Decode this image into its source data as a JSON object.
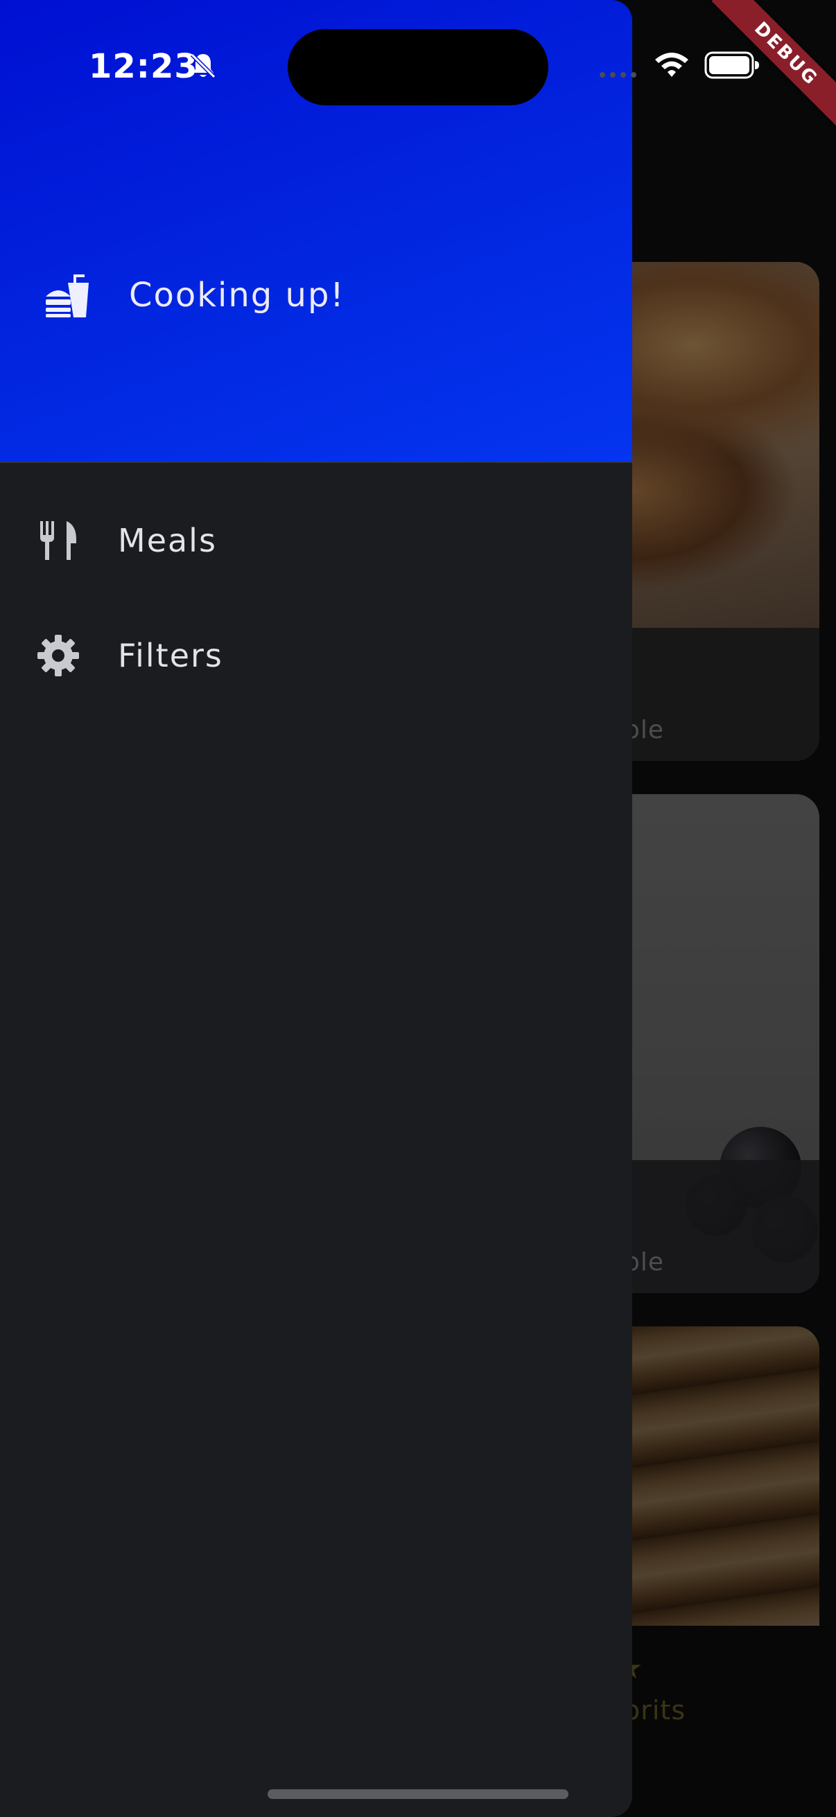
{
  "status_bar": {
    "time": "12:23",
    "icons": [
      "bell-slash-icon",
      "cellular-signal-icon",
      "wifi-icon",
      "battery-icon"
    ]
  },
  "debug_banner": {
    "label": "DEBUG",
    "color": "#8a1f2a"
  },
  "drawer": {
    "header": {
      "icon": "fastfood-icon",
      "title": "Cooking up!",
      "gradient": [
        "#0010d2",
        "#0435f0"
      ]
    },
    "items": [
      {
        "icon": "restaurant-icon",
        "label": "Meals"
      },
      {
        "icon": "settings-icon",
        "label": "Filters"
      }
    ]
  },
  "background": {
    "meal_cards": [
      {
        "meta_fragment": "ple"
      },
      {
        "meta_fragment": "ple"
      },
      {
        "meta_fragment": ""
      }
    ],
    "bottom_nav": {
      "icon": "star-icon",
      "label_fragment": "orits",
      "accent": "#6f6520"
    }
  },
  "colors": {
    "drawer_bg": "#1a1c20",
    "text": "#e3e3e8"
  }
}
